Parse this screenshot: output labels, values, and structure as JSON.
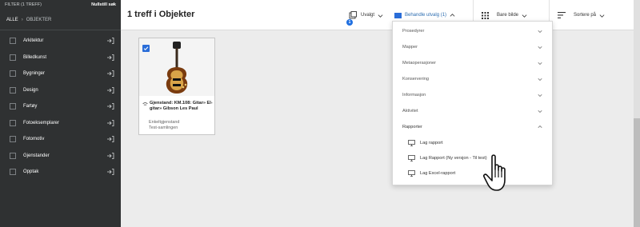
{
  "sidebar": {
    "filter_label": "FILTER (1 TREFF)",
    "reset_label": "Nullstill søk",
    "breadcrumb": [
      "ALLE",
      "OBJEKTER"
    ],
    "items": [
      {
        "label": "Arkitektur"
      },
      {
        "label": "Billedkunst"
      },
      {
        "label": "Bygninger"
      },
      {
        "label": "Design"
      },
      {
        "label": "Fartøy"
      },
      {
        "label": "Fotoeksemplarer"
      },
      {
        "label": "Fotomotiv"
      },
      {
        "label": "Gjenstander"
      },
      {
        "label": "Opptak"
      }
    ]
  },
  "header": {
    "title": "1 treff i Objekter",
    "unvalgt_label": "Uvalgt",
    "unvalgt_count": "1",
    "behandle_label": "Behandle utvalg (1)",
    "view_label": "Bare bilde",
    "sort_label": "Sortere på"
  },
  "card": {
    "title": "Gjenstand: KM.108: Gitar» El-gitar» Gibson Les Paul",
    "subtitle_line1": "Enkeltgjenstand",
    "subtitle_line2": "Test-samlingen"
  },
  "dropdown": {
    "sections": [
      {
        "label": "Prosedyrer"
      },
      {
        "label": "Mapper"
      },
      {
        "label": "Metaoperasjoner"
      },
      {
        "label": "Konservering"
      },
      {
        "label": "Informasjon"
      },
      {
        "label": "Aktivitet"
      }
    ],
    "open_section": "Rapporter",
    "reports": [
      {
        "label": "Lag rapport"
      },
      {
        "label": "Lag Rapport (Ny versjon - Til test)"
      },
      {
        "label": "Lag Excel-rapport"
      }
    ]
  },
  "colors": {
    "sidebar_bg": "#2f3132",
    "accent": "#2a6dd8"
  }
}
